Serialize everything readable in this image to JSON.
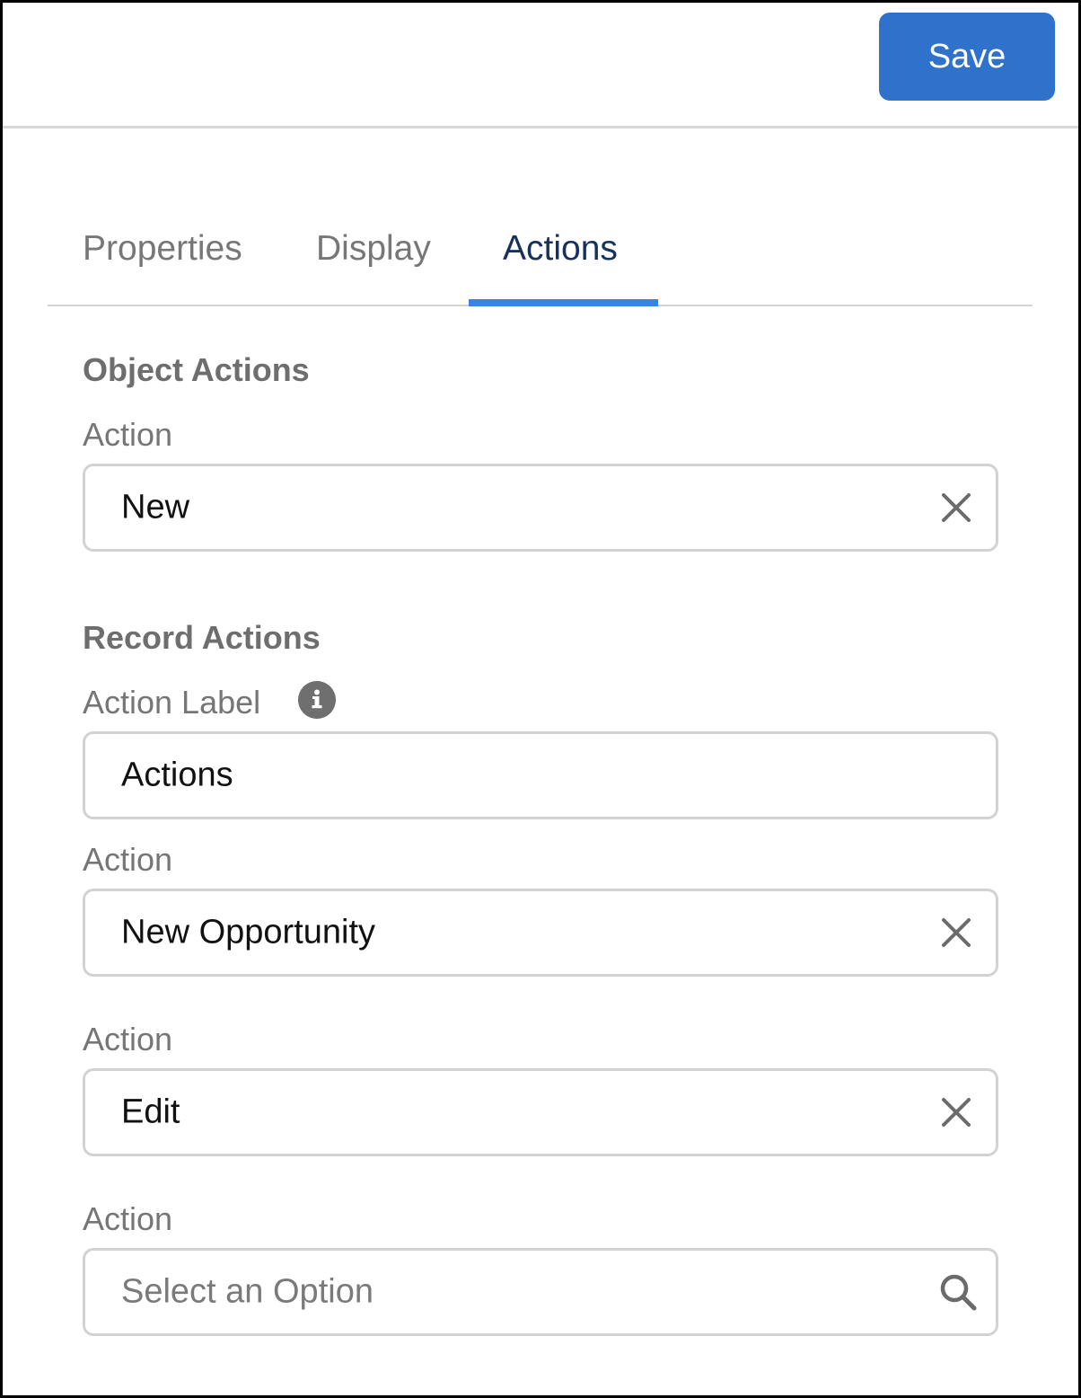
{
  "header": {
    "save_label": "Save",
    "accent_color": "#2f72cc"
  },
  "tabs": [
    {
      "label": "Properties",
      "active": false
    },
    {
      "label": "Display",
      "active": false
    },
    {
      "label": "Actions",
      "active": true
    }
  ],
  "object_actions": {
    "title": "Object Actions",
    "fields": [
      {
        "label": "Action",
        "value": "New",
        "icon": "clear-icon"
      }
    ]
  },
  "record_actions": {
    "title": "Record Actions",
    "action_label": {
      "label": "Action Label",
      "info_icon": "info-icon",
      "value": "Actions"
    },
    "fields": [
      {
        "label": "Action",
        "value": "New Opportunity",
        "icon": "clear-icon"
      },
      {
        "label": "Action",
        "value": "Edit",
        "icon": "clear-icon"
      },
      {
        "label": "Action",
        "value": "",
        "placeholder": "Select an Option",
        "icon": "search-icon"
      }
    ]
  }
}
